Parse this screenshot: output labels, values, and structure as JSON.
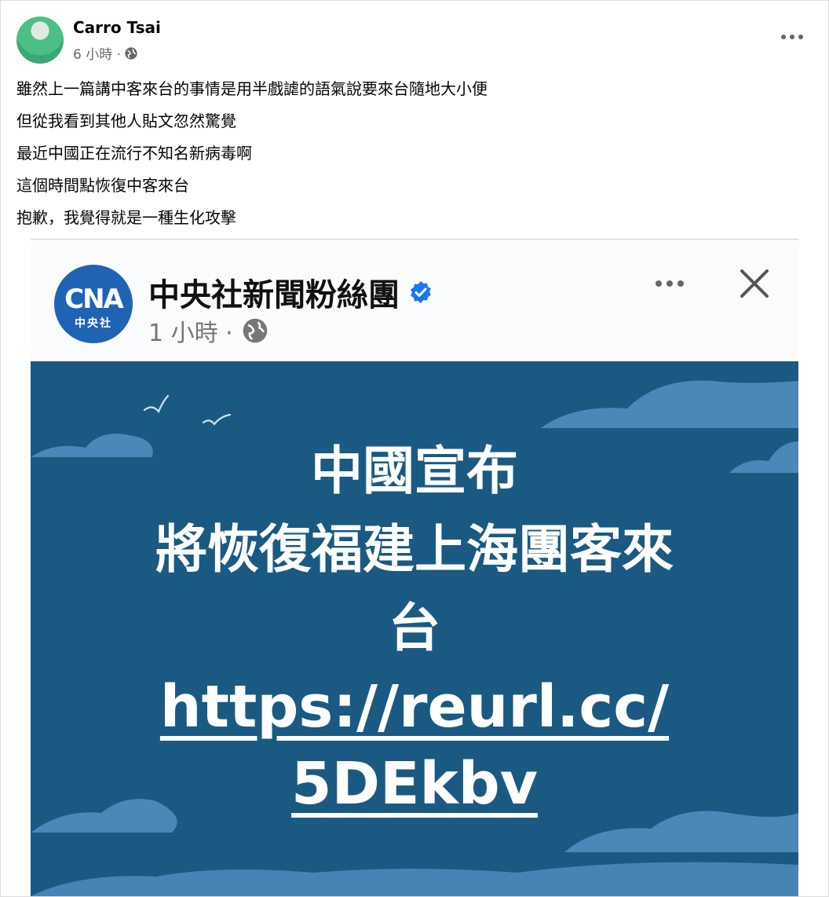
{
  "post": {
    "author": "Carro Tsai",
    "time": "6 小時 ·",
    "lines": [
      "雖然上一篇講中客來台的事情是用半戲謔的語氣說要來台隨地大小便",
      "但從我看到其他人貼文忽然驚覺",
      "最近中國正在流行不知名新病毒啊",
      "這個時間點恢復中客來台",
      "抱歉，我覺得就是一種生化攻擊"
    ]
  },
  "shared": {
    "page_name": "中央社新聞粉絲團",
    "time": "1 小時 ·",
    "logo_mark": "CNA",
    "logo_sub": "中央社",
    "card": {
      "headline": [
        "中國宣布",
        "將恢復福建上海團客來",
        "台"
      ],
      "link_line1": "https://reurl.cc/",
      "link_line2": "5DEkbv"
    }
  },
  "colors": {
    "card_bg": "#1a5a82",
    "cloud": "#4a88b8",
    "verified": "#1877f2",
    "logo": "#1f63b5"
  }
}
